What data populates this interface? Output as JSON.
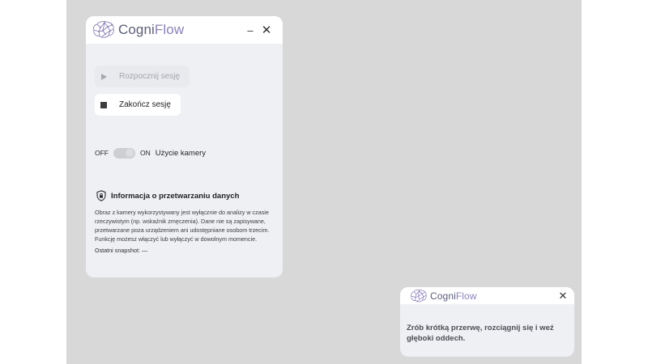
{
  "app": {
    "name_part1": "Cogni",
    "name_part2": "Flow",
    "brand_color": "#8c7fc1",
    "text_color": "#5a5e7a"
  },
  "window": {
    "minimize_icon": "–",
    "close_icon": "✕"
  },
  "controls": {
    "start_label": "Rozpocznij sesję",
    "start_enabled": false,
    "stop_label": "Zakończ sesję",
    "stop_enabled": true
  },
  "camera": {
    "off_label": "OFF",
    "on_label": "ON",
    "label": "Użycie kamery",
    "state": "off"
  },
  "info": {
    "title": "Informacja o przetwarzaniu danych",
    "body": "Obraz z kamery wykorzystywany jest wyłącznie do analizy w czasie rzeczywistym (np. wskaźnik zmęczenia). Dane nie są zapisywane, przetwarzane poza urządzeniem ani udostępniane osobom trzecim. Funkcję możesz włączyć lub wyłączyć w dowolnym momencie.",
    "snapshot_label": "Ostatni snapshot:",
    "snapshot_value": "—"
  },
  "toast": {
    "close_icon": "✕",
    "message": "Zrób krótką przerwę, rozciągnij się i weź głęboki oddech."
  },
  "colors": {
    "desktop": "#d8d8d8",
    "window_bg": "#eef0f3",
    "titlebar_bg": "#ffffff"
  }
}
